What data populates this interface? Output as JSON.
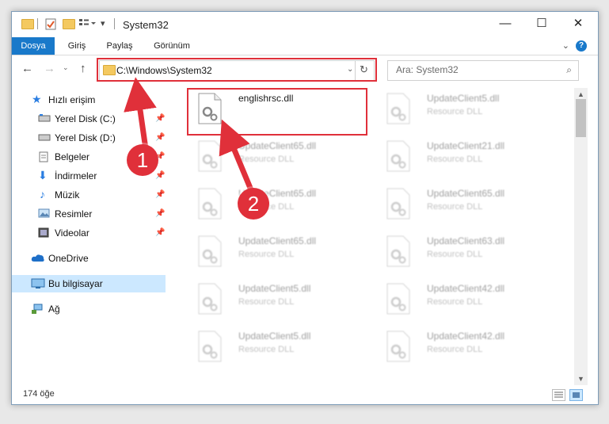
{
  "window": {
    "title": "System32",
    "minimize": "—",
    "maximize": "☐",
    "close": "✕"
  },
  "ribbon": {
    "tabs": [
      {
        "label": "Dosya",
        "active": true
      },
      {
        "label": "Giriş",
        "active": false
      },
      {
        "label": "Paylaş",
        "active": false
      },
      {
        "label": "Görünüm",
        "active": false
      }
    ],
    "help": "?"
  },
  "navbar": {
    "address": "C:\\Windows\\System32",
    "search_placeholder": "Ara: System32"
  },
  "sidebar": {
    "items": [
      {
        "label": "Hızlı erişim",
        "icon": "star-icon",
        "pinned": false
      },
      {
        "label": "Yerel Disk (C:)",
        "icon": "drive-icon",
        "pinned": true
      },
      {
        "label": "Yerel Disk (D:)",
        "icon": "drive-icon",
        "pinned": true
      },
      {
        "label": "Belgeler",
        "icon": "documents-icon",
        "pinned": true
      },
      {
        "label": "İndirmeler",
        "icon": "download-icon",
        "pinned": true
      },
      {
        "label": "Müzik",
        "icon": "music-icon",
        "pinned": true
      },
      {
        "label": "Resimler",
        "icon": "pictures-icon",
        "pinned": true
      },
      {
        "label": "Videolar",
        "icon": "videos-icon",
        "pinned": true
      },
      {
        "label": "OneDrive",
        "icon": "cloud-icon",
        "pinned": false
      },
      {
        "label": "Bu bilgisayar",
        "icon": "computer-icon",
        "pinned": false,
        "selected": true
      },
      {
        "label": "Ağ",
        "icon": "network-icon",
        "pinned": false
      }
    ]
  },
  "files": [
    {
      "name": "englishrsc.dll",
      "type": "",
      "highlighted": true
    },
    {
      "name": "UpdateClient5.dll",
      "type": "Resource DLL"
    },
    {
      "name": "UpdateClient65.dll",
      "type": "Resource DLL"
    },
    {
      "name": "UpdateClient21.dll",
      "type": "Resource DLL"
    },
    {
      "name": "UpdateClient65.dll",
      "type": "Resource DLL"
    },
    {
      "name": "UpdateClient65.dll",
      "type": "Resource DLL"
    },
    {
      "name": "UpdateClient65.dll",
      "type": "Resource DLL"
    },
    {
      "name": "UpdateClient63.dll",
      "type": "Resource DLL"
    },
    {
      "name": "UpdateClient5.dll",
      "type": "Resource DLL"
    },
    {
      "name": "UpdateClient42.dll",
      "type": "Resource DLL"
    },
    {
      "name": "UpdateClient5.dll",
      "type": "Resource DLL"
    },
    {
      "name": "UpdateClient42.dll",
      "type": "Resource DLL"
    }
  ],
  "status": {
    "count": "174 öğe"
  },
  "annotations": {
    "step1": "1",
    "step2": "2",
    "color": "#e0303a"
  }
}
